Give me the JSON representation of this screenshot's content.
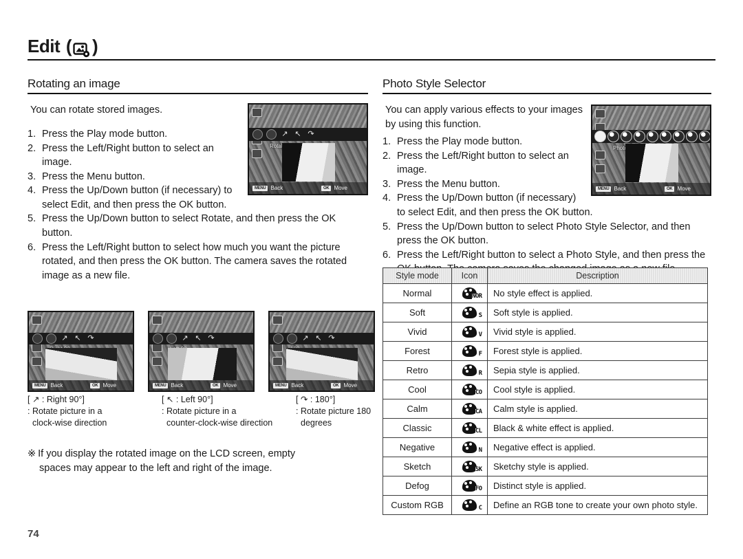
{
  "page": {
    "title": "Edit",
    "title_icon": "edit-photo-gear-icon",
    "number": "74"
  },
  "left_column": {
    "heading": "Rotating an image",
    "intro": "You can rotate stored images.",
    "steps": [
      {
        "num": "1.",
        "text": "Press the Play mode button."
      },
      {
        "num": "2.",
        "text": "Press the Left/Right button to select an image."
      },
      {
        "num": "3.",
        "text": "Press the Menu button."
      },
      {
        "num": "4.",
        "text": "Press the Up/Down button (if necessary) to select Edit, and then press the OK button."
      },
      {
        "num": "5.",
        "text": "Press the Up/Down button to select Rotate, and then press the OK button."
      },
      {
        "num": "6.",
        "text": "Press the Left/Right button to select how much you want the picture rotated, and then press the OK button. The camera saves the rotated image as a new file."
      }
    ],
    "lcd_rotate": {
      "menu_label": "Rotate",
      "back_key": "MENU",
      "back_label": "Back",
      "move_key": "OK",
      "move_label": "Move"
    },
    "rotate_shots": [
      {
        "menu_label": "Right 90",
        "back_key": "MENU",
        "back_label": "Back",
        "move_key": "OK",
        "move_label": "Move"
      },
      {
        "menu_label": "Left 90",
        "back_key": "MENU",
        "back_label": "Back",
        "move_key": "OK",
        "move_label": "Move"
      },
      {
        "menu_label": "180",
        "back_key": "MENU",
        "back_label": "Back",
        "move_key": "OK",
        "move_label": "Move"
      }
    ],
    "rotate_captions": [
      {
        "icon": "rotate-right-arrow-icon",
        "header": "[ ↗ : Right 90°]",
        "line2": ": Rotate picture in a",
        "line3": "clock-wise direction"
      },
      {
        "icon": "rotate-left-arrow-icon",
        "header": "[ ↖ : Left 90°]",
        "line2": ": Rotate picture in a",
        "line3": "counter-clock-wise direction"
      },
      {
        "icon": "rotate-180-arrow-icon",
        "header": "[ ↷ : 180°]",
        "line2": ": Rotate picture 180",
        "line3": "degrees"
      }
    ],
    "note": {
      "mark": "※",
      "line1": "If you display the rotated image on the LCD screen, empty",
      "line2": "spaces may appear to the left and right of the image."
    }
  },
  "right_column": {
    "heading": "Photo Style Selector",
    "intro": "You can apply various effects to your images by using this function.",
    "steps": [
      {
        "num": "1.",
        "text": "Press the Play mode button."
      },
      {
        "num": "2.",
        "text": "Press the Left/Right button to select an image."
      },
      {
        "num": "3.",
        "text": "Press the Menu button."
      },
      {
        "num": "4.",
        "text": "Press the Up/Down button (if necessary) to select Edit, and then press the OK button."
      },
      {
        "num": "5.",
        "text": "Press the Up/Down button to select Photo Style Selector, and then press the OK button."
      },
      {
        "num": "6.",
        "text": "Press the Left/Right button to select a Photo Style, and then press the OK button. The camera saves the changed image as a new file."
      }
    ],
    "lcd_psl": {
      "menu_label": "Photo Style Selector",
      "back_key": "MENU",
      "back_label": "Back",
      "move_key": "OK",
      "move_label": "Move"
    }
  },
  "style_table": {
    "headers": [
      "Style mode",
      "Icon",
      "Description"
    ],
    "rows": [
      {
        "mode": "Normal",
        "icon": "palette-normal-icon",
        "icon_label": "NOR",
        "desc": "No style effect is applied."
      },
      {
        "mode": "Soft",
        "icon": "palette-soft-icon",
        "icon_label": "S",
        "desc": "Soft style is applied."
      },
      {
        "mode": "Vivid",
        "icon": "palette-vivid-icon",
        "icon_label": "V",
        "desc": "Vivid style is applied."
      },
      {
        "mode": "Forest",
        "icon": "palette-forest-icon",
        "icon_label": "F",
        "desc": "Forest style is applied."
      },
      {
        "mode": "Retro",
        "icon": "palette-retro-icon",
        "icon_label": "R",
        "desc": "Sepia style is applied."
      },
      {
        "mode": "Cool",
        "icon": "palette-cool-icon",
        "icon_label": "CO",
        "desc": "Cool style is applied."
      },
      {
        "mode": "Calm",
        "icon": "palette-calm-icon",
        "icon_label": "CA",
        "desc": "Calm style is applied."
      },
      {
        "mode": "Classic",
        "icon": "palette-classic-icon",
        "icon_label": "CL",
        "desc": "Black & white effect is applied."
      },
      {
        "mode": "Negative",
        "icon": "palette-negative-icon",
        "icon_label": "N",
        "desc": "Negative effect is applied."
      },
      {
        "mode": "Sketch",
        "icon": "palette-sketch-icon",
        "icon_label": "SK",
        "desc": "Sketchy style is applied."
      },
      {
        "mode": "Defog",
        "icon": "palette-defog-icon",
        "icon_label": "FO",
        "desc": "Distinct style is applied."
      },
      {
        "mode": "Custom RGB",
        "icon": "palette-custom-rgb-icon",
        "icon_label": "C",
        "desc": "Define an RGB tone to create your own photo style."
      }
    ]
  }
}
